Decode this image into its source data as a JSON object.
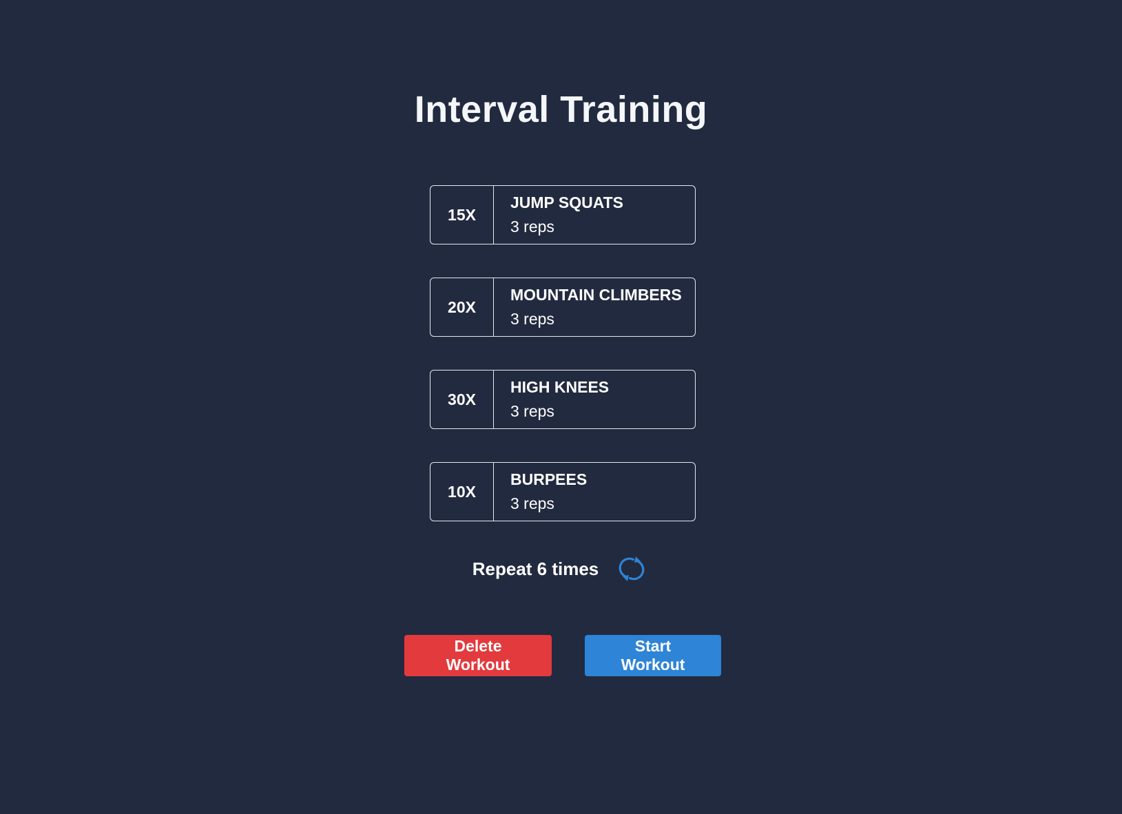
{
  "page": {
    "title": "Interval Training"
  },
  "exercises": [
    {
      "count": "15X",
      "name": "JUMP SQUATS",
      "reps": "3 reps"
    },
    {
      "count": "20X",
      "name": "MOUNTAIN CLIMBERS",
      "reps": "3 reps"
    },
    {
      "count": "30X",
      "name": "HIGH KNEES",
      "reps": "3 reps"
    },
    {
      "count": "10X",
      "name": "BURPEES",
      "reps": "3 reps"
    }
  ],
  "repeat": {
    "text": "Repeat 6 times",
    "icon": "refresh-icon"
  },
  "actions": {
    "delete_label": "Delete Workout",
    "start_label": "Start Workout"
  },
  "colors": {
    "background": "#222a3f",
    "delete": "#e23a3d",
    "start": "#2e84d6",
    "icon": "#2e84d6"
  }
}
